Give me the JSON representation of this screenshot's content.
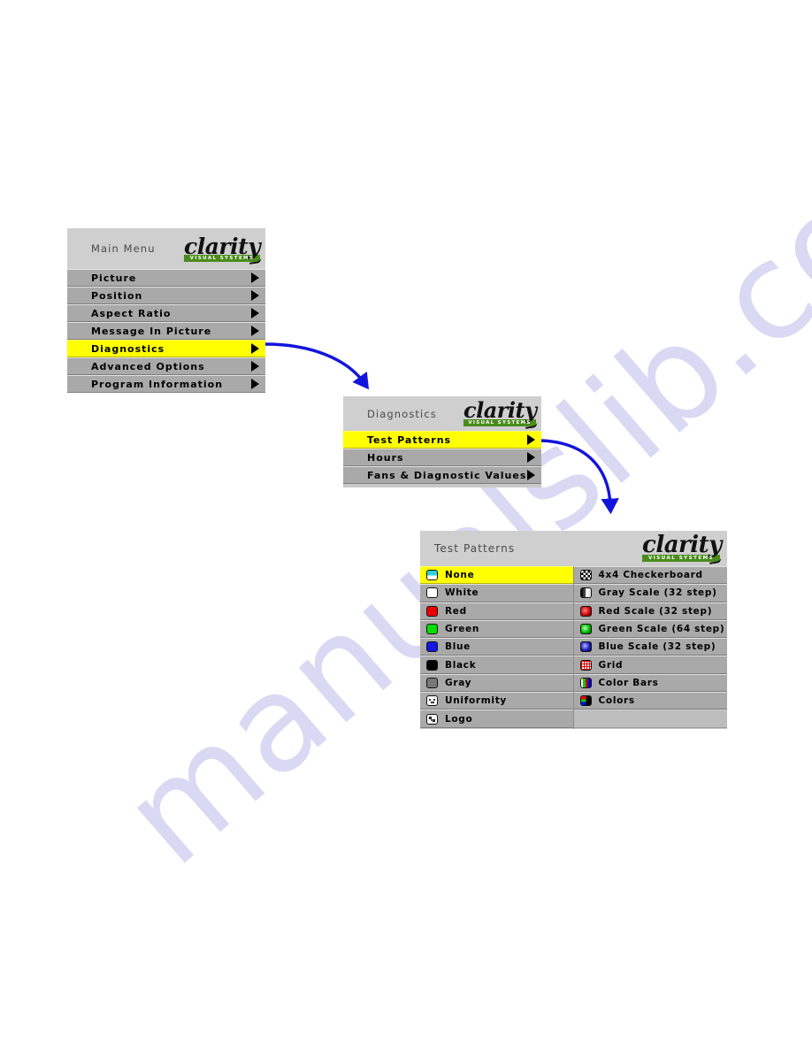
{
  "logo": {
    "word": "clarity",
    "tagline": "VISUAL SYSTEMS"
  },
  "main_menu": {
    "title": "Main Menu",
    "items": [
      {
        "label": "Picture",
        "selected": false,
        "arrow": true
      },
      {
        "label": "Position",
        "selected": false,
        "arrow": true
      },
      {
        "label": "Aspect Ratio",
        "selected": false,
        "arrow": true
      },
      {
        "label": "Message In Picture",
        "selected": false,
        "arrow": true
      },
      {
        "label": "Diagnostics",
        "selected": true,
        "arrow": true
      },
      {
        "label": "Advanced Options",
        "selected": false,
        "arrow": true
      },
      {
        "label": "Program Information",
        "selected": false,
        "arrow": true
      }
    ]
  },
  "diagnostics_menu": {
    "title": "Diagnostics",
    "items": [
      {
        "label": "Test Patterns",
        "selected": true,
        "arrow": true
      },
      {
        "label": "Hours",
        "selected": false,
        "arrow": true
      },
      {
        "label": "Fans & Diagnostic Values",
        "selected": false,
        "arrow": true
      }
    ]
  },
  "test_patterns": {
    "title": "Test Patterns",
    "left_column": [
      {
        "label": "None",
        "icon": "none-pattern-icon",
        "selected": true
      },
      {
        "label": "White",
        "icon": "white-swatch-icon",
        "selected": false
      },
      {
        "label": "Red",
        "icon": "red-swatch-icon",
        "selected": false
      },
      {
        "label": "Green",
        "icon": "green-swatch-icon",
        "selected": false
      },
      {
        "label": "Blue",
        "icon": "blue-swatch-icon",
        "selected": false
      },
      {
        "label": "Black",
        "icon": "black-swatch-icon",
        "selected": false
      },
      {
        "label": "Gray",
        "icon": "gray-swatch-icon",
        "selected": false
      },
      {
        "label": "Uniformity",
        "icon": "uniformity-icon",
        "selected": false
      },
      {
        "label": "Logo",
        "icon": "logo-pattern-icon",
        "selected": false
      }
    ],
    "right_column": [
      {
        "label": "4x4 Checkerboard",
        "icon": "checkerboard-icon",
        "selected": false
      },
      {
        "label": "Gray Scale (32 step)",
        "icon": "gray-scale-icon",
        "selected": false
      },
      {
        "label": "Red Scale (32 step)",
        "icon": "red-scale-icon",
        "selected": false
      },
      {
        "label": "Green Scale (64 step)",
        "icon": "green-scale-icon",
        "selected": false
      },
      {
        "label": "Blue Scale (32 step)",
        "icon": "blue-scale-icon",
        "selected": false
      },
      {
        "label": "Grid",
        "icon": "grid-icon",
        "selected": false
      },
      {
        "label": "Color Bars",
        "icon": "color-bars-icon",
        "selected": false
      },
      {
        "label": "Colors",
        "icon": "colors-icon",
        "selected": false
      },
      {
        "label": "",
        "icon": "",
        "selected": false
      }
    ]
  },
  "connectors": [
    {
      "name": "main-to-diagnostics",
      "color": "#1414dc"
    },
    {
      "name": "diagnostics-to-test-patterns",
      "color": "#1414dc"
    }
  ],
  "watermark": {
    "text": "manualslib.com",
    "color": "#c9c9ef"
  },
  "colors": {
    "panel_header": "#cfcfcf",
    "row": "#a9a9a9",
    "selected_row": "#ffff00",
    "logo_green": "#4a8c1c",
    "arrow_blue": "#1414dc"
  }
}
